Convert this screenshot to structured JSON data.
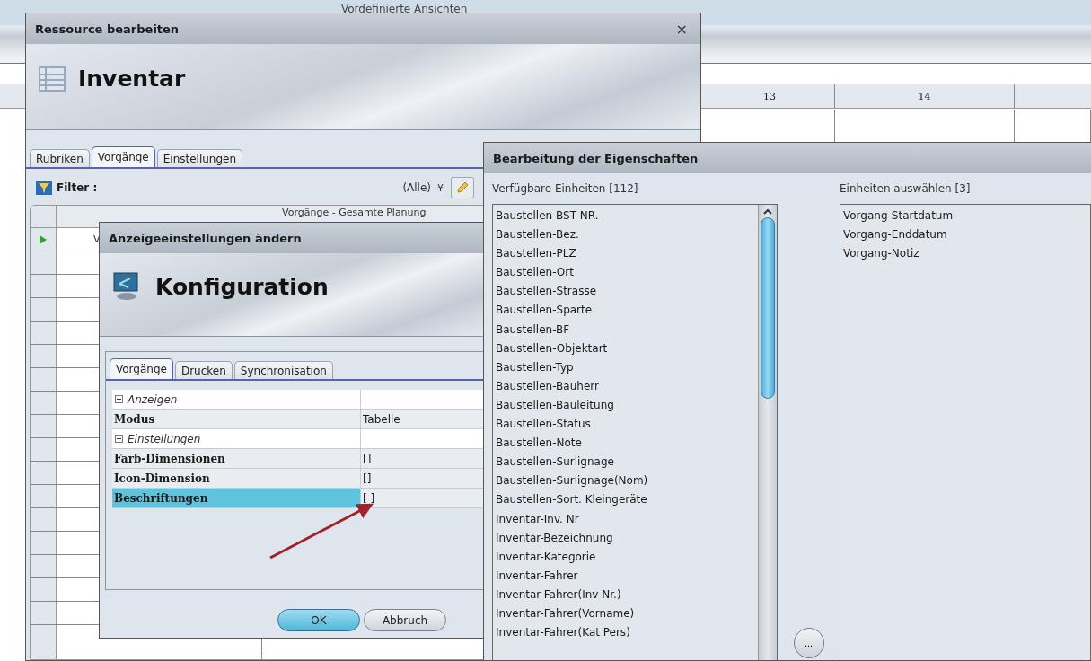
{
  "background": {
    "top_label": "Vordefinierte Ansichten",
    "day_headers": [
      "13",
      "14"
    ]
  },
  "resource_window": {
    "title": "Ressource bearbeiten",
    "close": "×",
    "header_title": "Inventar",
    "tabs": [
      {
        "label": "Rubriken",
        "selected": false
      },
      {
        "label": "Vorgänge",
        "selected": true
      },
      {
        "label": "Einstellungen",
        "selected": false
      }
    ],
    "filter": {
      "label": "Filter :",
      "value": "(Alle)",
      "chevron": "¥"
    },
    "grid": {
      "column_header": "Vorgänge - Gesamte Planung",
      "column_2": "V"
    }
  },
  "config_dialog": {
    "title": "Anzeigeeinstellungen ändern",
    "header_title": "Konfiguration",
    "tabs": [
      {
        "label": "Vorgänge",
        "selected": true
      },
      {
        "label": "Drucken",
        "selected": false
      },
      {
        "label": "Synchronisation",
        "selected": false
      }
    ],
    "properties": [
      {
        "kind": "category",
        "label": "Anzeigen",
        "expanded": true
      },
      {
        "kind": "property",
        "label": "Modus",
        "value": "Tabelle",
        "selected": false
      },
      {
        "kind": "category",
        "label": "Einstellungen",
        "expanded": true
      },
      {
        "kind": "property",
        "label": "Farb-Dimensionen",
        "value": "[]",
        "selected": false
      },
      {
        "kind": "property",
        "label": "Icon-Dimension",
        "value": "[]",
        "selected": false
      },
      {
        "kind": "property",
        "label": "Beschriftungen",
        "value": "[ ]",
        "selected": true
      }
    ],
    "buttons": [
      {
        "label": "OK",
        "kind": "default"
      },
      {
        "label": "Abbruch",
        "kind": "normal"
      }
    ]
  },
  "properties_dialog": {
    "title": "Bearbeitung der Eigenschaften",
    "available": {
      "label": "Verfügbare Einheiten [112]",
      "items": [
        "Baustellen-BST NR.",
        "Baustellen-Bez.",
        "Baustellen-PLZ",
        "Baustellen-Ort",
        "Baustellen-Strasse",
        "Baustellen-Sparte",
        "Baustellen-BF",
        "Baustellen-Objektart",
        "Baustellen-Typ",
        "Baustellen-Bauherr",
        "Baustellen-Bauleitung",
        "Baustellen-Status",
        "Baustellen-Note",
        "Baustellen-Surlignage",
        "Baustellen-Surlignage(Nom)",
        "Baustellen-Sort. Kleingeräte",
        "Inventar-Inv. Nr",
        "Inventar-Bezeichnung",
        "Inventar-Kategorie",
        "Inventar-Fahrer",
        "Inventar-Fahrer(Inv Nr.)",
        "Inventar-Fahrer(Vorname)",
        "Inventar-Fahrer(Kat Pers)"
      ]
    },
    "selected_units": {
      "label": "Einheiten auswählen [3]",
      "items": [
        "Vorgang-Startdatum",
        "Vorgang-Enddatum",
        "Vorgang-Notiz"
      ]
    },
    "more_button": "..."
  }
}
